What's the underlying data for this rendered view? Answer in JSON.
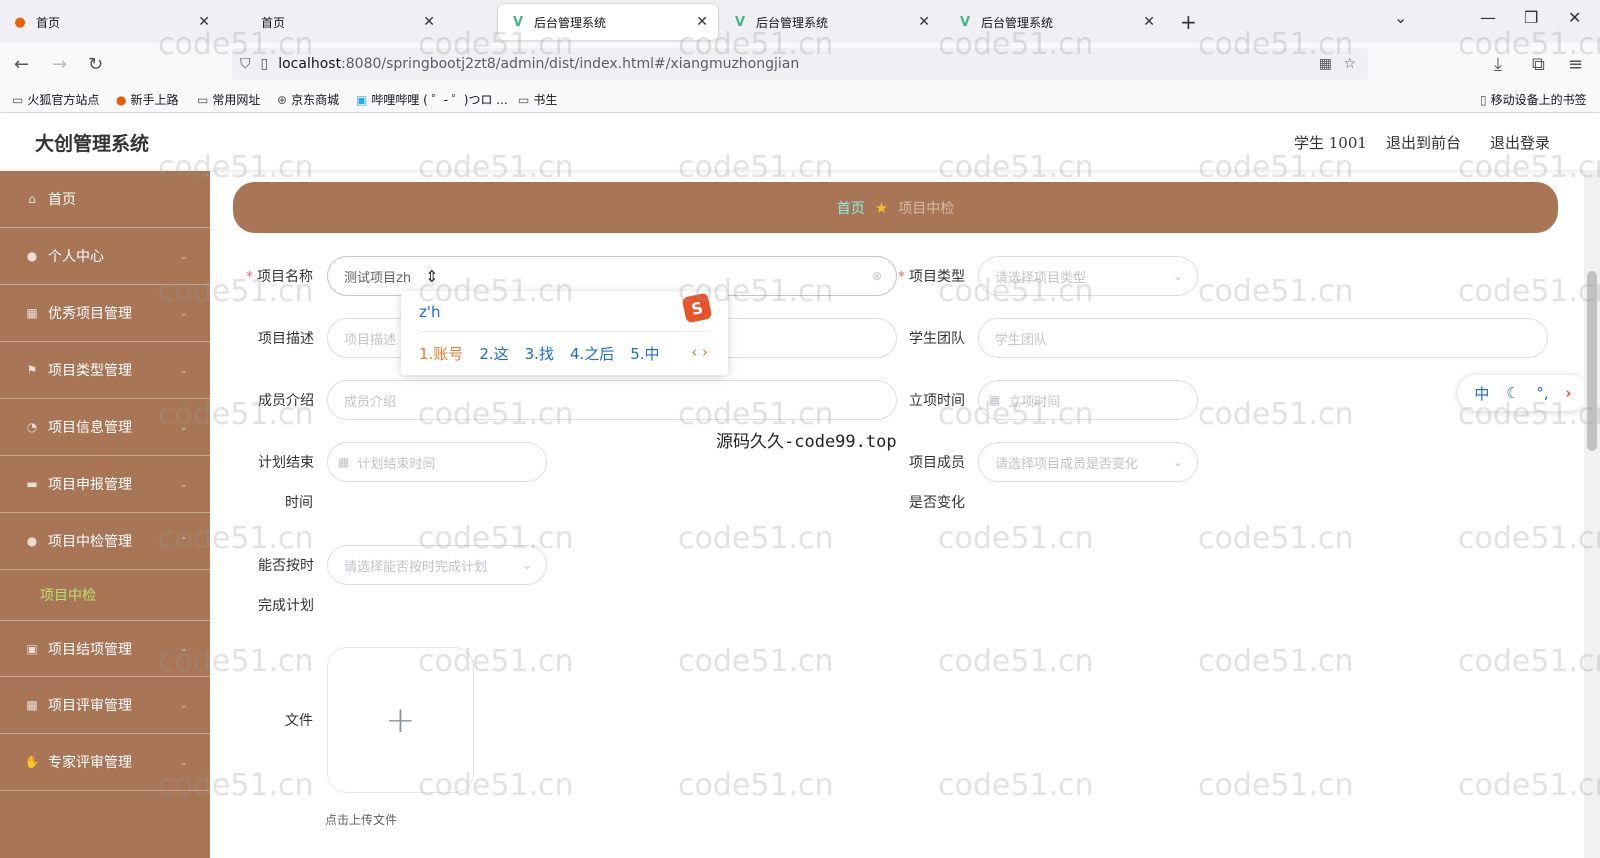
{
  "browser": {
    "tabs": [
      {
        "label": "首页",
        "favicon": "firefox-icon",
        "active": false
      },
      {
        "label": "首页",
        "favicon": "none",
        "active": false
      },
      {
        "label": "后台管理系统",
        "favicon": "vue-icon",
        "active": true
      },
      {
        "label": "后台管理系统",
        "favicon": "vue-icon",
        "active": false
      },
      {
        "label": "后台管理系统",
        "favicon": "vue-icon",
        "active": false
      }
    ],
    "url_host": "localhost",
    "url_rest": ":8080/springbootj2zt8/admin/dist/index.html#/xiangmuzhongjian",
    "bookmarks": [
      "火狐官方站点",
      "新手上路",
      "常用网址",
      "京东商城",
      "哔哩哔哩 ( ゜- ゜)つロ ...",
      "书生"
    ],
    "mobile_bookmarks": "移动设备上的书签"
  },
  "header": {
    "title": "大创管理系统",
    "user": "学生 1001",
    "to_front": "退出到前台",
    "logout": "退出登录"
  },
  "sidebar": {
    "items": [
      {
        "label": "首页",
        "icon": "home-icon"
      },
      {
        "label": "个人中心",
        "icon": "user-icon"
      },
      {
        "label": "优秀项目管理",
        "icon": "grid-icon"
      },
      {
        "label": "项目类型管理",
        "icon": "flag-icon"
      },
      {
        "label": "项目信息管理",
        "icon": "info-icon"
      },
      {
        "label": "项目申报管理",
        "icon": "chat-icon"
      },
      {
        "label": "项目中检管理",
        "icon": "user-icon"
      },
      {
        "label": "项目结项管理",
        "icon": "image-icon"
      },
      {
        "label": "项目评审管理",
        "icon": "apps-icon"
      },
      {
        "label": "专家评审管理",
        "icon": "thumb-icon"
      }
    ],
    "active_sub": "项目中检",
    "active_color": "#b7e36b"
  },
  "breadcrumb": {
    "home": "首页",
    "current": "项目中检"
  },
  "form": {
    "name_label": "项目名称",
    "name_value": "测试项目zh",
    "type_label": "项目类型",
    "type_placeholder": "请选择项目类型",
    "desc_label": "项目描述",
    "desc_placeholder": "项目描述",
    "team_label": "学生团队",
    "team_placeholder": "学生团队",
    "members_label": "成员介绍",
    "members_placeholder": "成员介绍",
    "start_label": "立项时间",
    "start_placeholder": "立项时间",
    "end_label_1": "计划结束",
    "end_label_2": "时间",
    "end_placeholder": "计划结束时间",
    "change_label_1": "项目成员",
    "change_label_2": "是否变化",
    "change_placeholder": "请选择项目成员是否变化",
    "ontime_label_1": "能否按时",
    "ontime_label_2": "完成计划",
    "ontime_placeholder": "请选择能否按时完成计划",
    "file_label": "文件",
    "upload_tip": "点击上传文件"
  },
  "ime": {
    "input": "z'h",
    "candidates": [
      "1.账号",
      "2.这",
      "3.找",
      "4.之后",
      "5.中"
    ],
    "status_lang": "中"
  },
  "overlay_text": "源码久久-code99.top",
  "watermark": "code51.cn",
  "colors": {
    "brand": "#a87656",
    "breadcrumb_home": "#89f2e3",
    "required": "#f56c6c"
  }
}
